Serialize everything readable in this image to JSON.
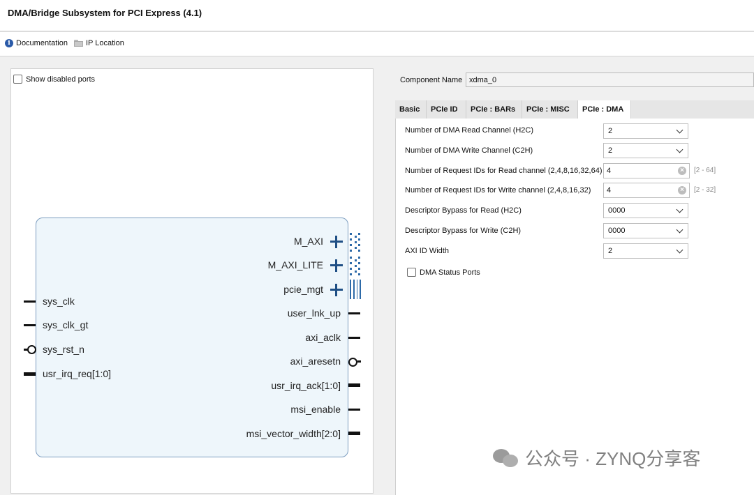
{
  "window": {
    "title": "DMA/Bridge Subsystem for PCI Express (4.1)"
  },
  "toolbar": {
    "documentation": "Documentation",
    "ip_location": "IP Location"
  },
  "symbol": {
    "show_disabled_ports": "Show disabled ports",
    "left_ports": [
      "sys_clk",
      "sys_clk_gt",
      "sys_rst_n",
      "usr_irq_req[1:0]"
    ],
    "right_ports": [
      "M_AXI",
      "M_AXI_LITE",
      "pcie_mgt",
      "user_lnk_up",
      "axi_aclk",
      "axi_aresetn",
      "usr_irq_ack[1:0]",
      "msi_enable",
      "msi_vector_width[2:0]"
    ]
  },
  "component": {
    "label": "Component Name",
    "value": "xdma_0"
  },
  "tabs": [
    "Basic",
    "PCIe ID",
    "PCIe : BARs",
    "PCIe : MISC",
    "PCIe : DMA"
  ],
  "active_tab": "PCIe : DMA",
  "dma_settings": {
    "read_channel": {
      "label": "Number of DMA Read Channel (H2C)",
      "value": "2"
    },
    "write_channel": {
      "label": "Number of DMA Write Channel (C2H)",
      "value": "2"
    },
    "req_ids_read": {
      "label": "Number of Request IDs for Read channel (2,4,8,16,32,64)",
      "value": "4",
      "range": "[2 - 64]"
    },
    "req_ids_write": {
      "label": "Number of Request IDs for Write channel (2,4,8,16,32)",
      "value": "4",
      "range": "[2 - 32]"
    },
    "bypass_read": {
      "label": "Descriptor Bypass for Read (H2C)",
      "value": "0000"
    },
    "bypass_write": {
      "label": "Descriptor Bypass for Write (C2H)",
      "value": "0000"
    },
    "axi_id_width": {
      "label": "AXI ID Width",
      "value": "2"
    },
    "dma_status_ports": {
      "label": "DMA Status Ports"
    }
  },
  "watermark": "公众号 · ZYNQ分享客"
}
